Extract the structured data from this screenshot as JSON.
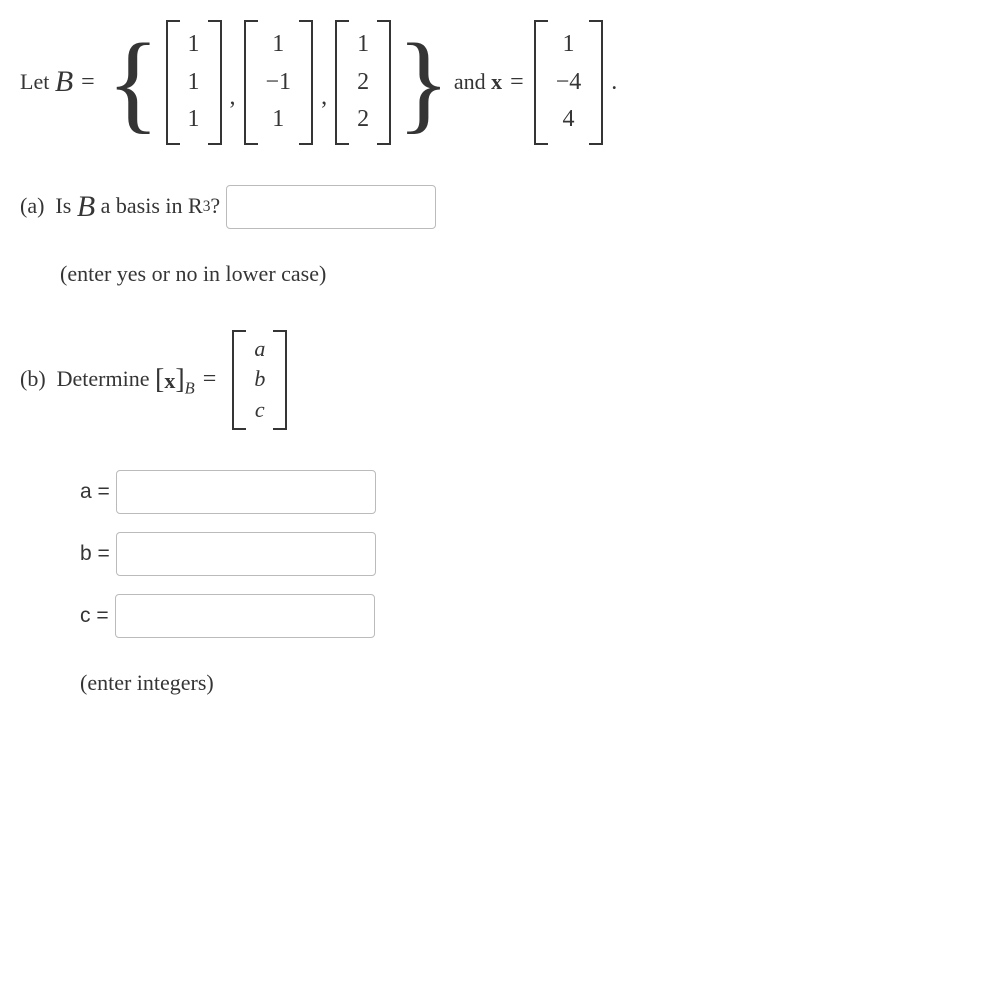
{
  "prefix": {
    "let": "Let",
    "B": "B",
    "eq": "="
  },
  "vectors": {
    "v1": [
      "1",
      "1",
      "1"
    ],
    "v2": [
      "1",
      "−1",
      "1"
    ],
    "v3": [
      "1",
      "2",
      "2"
    ],
    "x": [
      "1",
      "−4",
      "4"
    ]
  },
  "andx": "and",
  "xbold": "x",
  "period": ".",
  "parta": {
    "label": "(a)",
    "text1": "Is",
    "B": "B",
    "text2": "a basis in R",
    "sup": "3",
    "text3": "?",
    "hint": "(enter yes or no in lower case)"
  },
  "partb": {
    "label": "(b)",
    "text1": "Determine",
    "xB": {
      "x": "x",
      "B": "B"
    },
    "eq": "=",
    "rhs": [
      "a",
      "b",
      "c"
    ]
  },
  "answers": {
    "a_label": "a =",
    "b_label": "b =",
    "c_label": "c ="
  },
  "hint2": "(enter integers)"
}
